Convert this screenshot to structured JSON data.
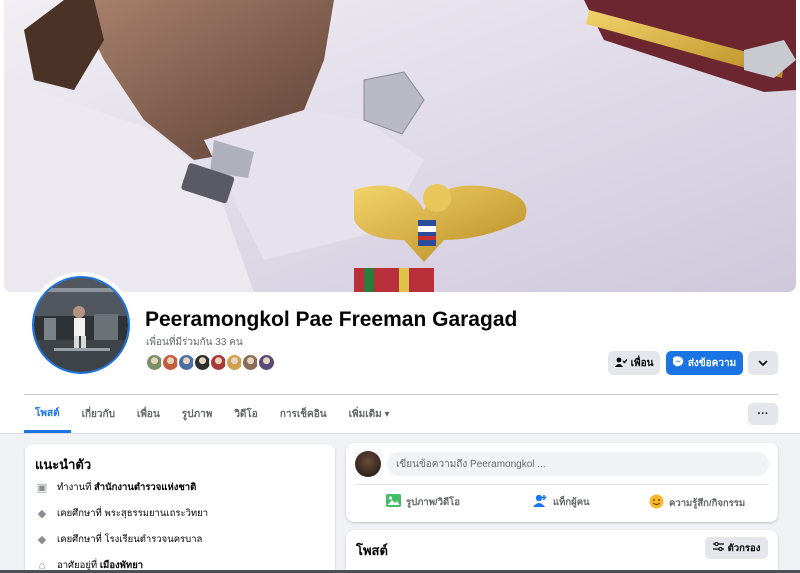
{
  "profile": {
    "name": "Peeramongkol Pae Freeman Garagad",
    "mutual_friends": "เพื่อนที่มีร่วมกัน 33 คน",
    "mutual_avatar_colors": [
      "#7a8f63",
      "#c65c3e",
      "#4a6fa5",
      "#2e2e2e",
      "#a83a3a",
      "#d0a050",
      "#8a6d5a",
      "#5a4a7a"
    ]
  },
  "actions": {
    "friend_label": "เพื่อน",
    "message_label": "ส่งข้อความ",
    "more_icon": "chevron-down-icon"
  },
  "tabs": [
    {
      "label": "โพสต์",
      "active": true
    },
    {
      "label": "เกี่ยวกับ"
    },
    {
      "label": "เพื่อน"
    },
    {
      "label": "รูปภาพ"
    },
    {
      "label": "วิดีโอ"
    },
    {
      "label": "การเช็คอิน"
    },
    {
      "label": "เพิ่มเติม ▾"
    }
  ],
  "tab_more_label": "···",
  "intro": {
    "title": "แนะนำตัว",
    "rows": [
      {
        "icon": "briefcase-icon",
        "prefix": "ทำงานที่ ",
        "bold": "สำนักงานตำรวจแห่งชาติ",
        "suffix": ""
      },
      {
        "icon": "graduation-cap-icon",
        "prefix": "เคยศึกษาที่ พระสุธรรมยานเถระวิทยา",
        "bold": "",
        "suffix": ""
      },
      {
        "icon": "graduation-cap-icon",
        "prefix": "เคยศึกษาที่ โรงเรียนตำรวจนครบาล",
        "bold": "",
        "suffix": ""
      },
      {
        "icon": "home-icon",
        "prefix": "อาศัยอยู่ที่ ",
        "bold": "เมืองพัทยา",
        "suffix": ""
      }
    ]
  },
  "composer": {
    "placeholder": "เขียนข้อความถึง Peeramongkol ...",
    "photo_label": "รูปภาพ/วิดีโอ",
    "tag_label": "แท็กผู้คน",
    "feeling_label": "ความรู้สึก/กิจกรรม"
  },
  "posts": {
    "title": "โพสต์",
    "filter_label": "ตัวกรอง"
  },
  "colors": {
    "accent": "#1b74e4",
    "photo_green": "#45bd62",
    "tag_blue": "#1877f2",
    "feeling_yellow": "#f7b928"
  }
}
